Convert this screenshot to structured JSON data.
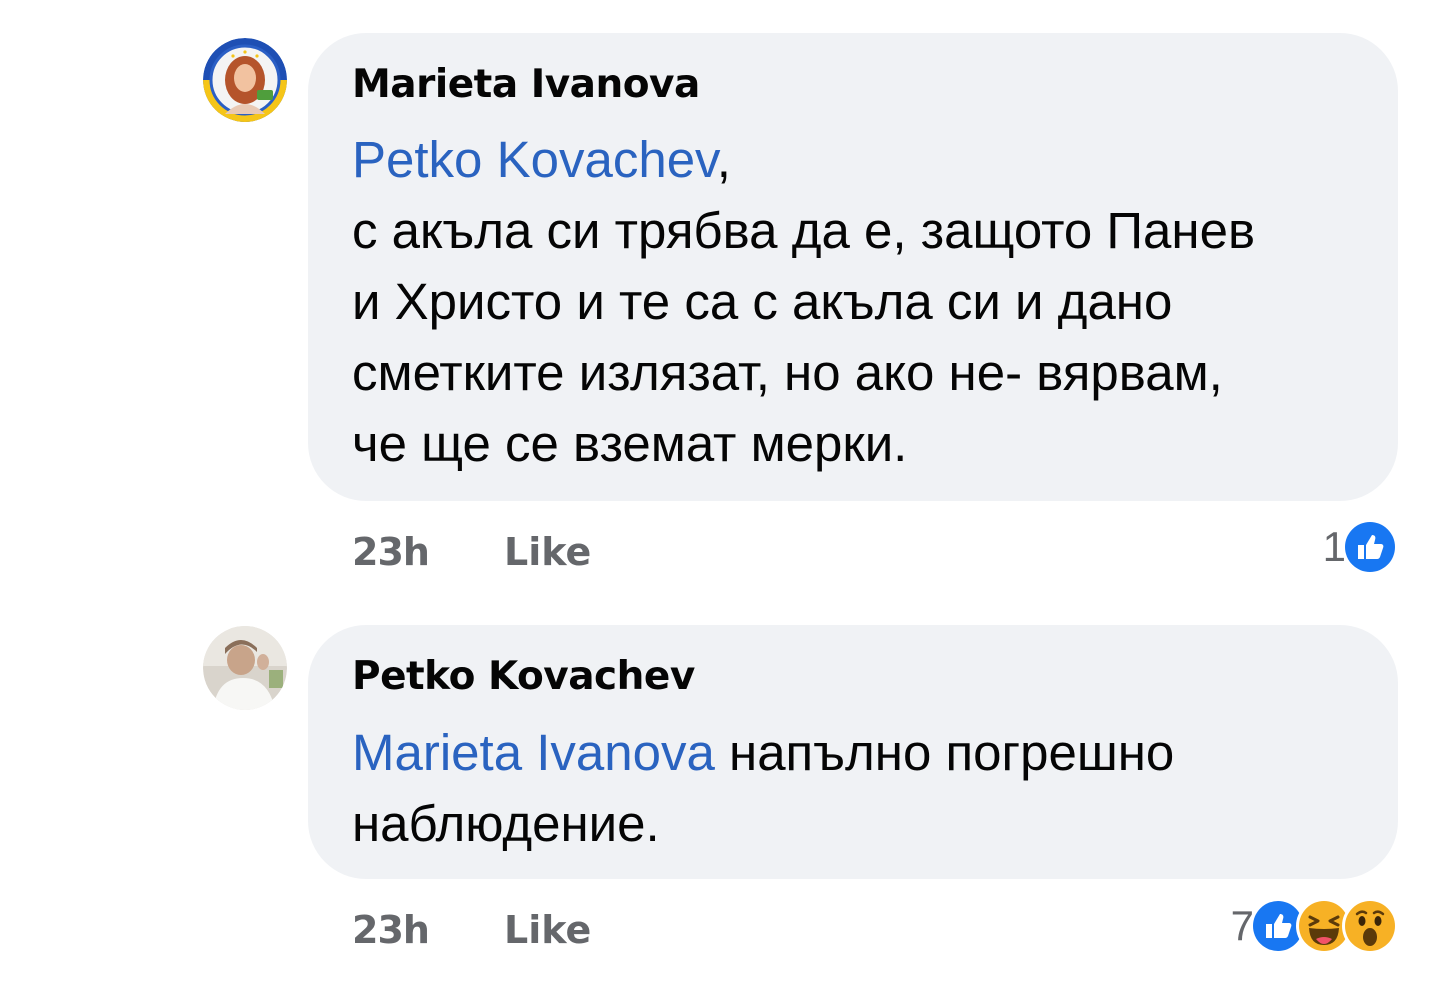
{
  "comments": [
    {
      "author": "Marieta Ivanova",
      "mention": "Petko Kovachev",
      "mention_suffix": ",",
      "body_lines": [
        "с акъла си трябва да е, защото Панев",
        "и Христо и те са с акъла си и дано",
        "сметките излязат, но ако не- вярвам,",
        "че ще се вземат мерки."
      ],
      "time": "23h",
      "like_label": "Like",
      "reaction_count": "1",
      "reaction_icons": [
        "like-icon"
      ],
      "avatar_icon": "avatar-woman-icon"
    },
    {
      "author": "Petko Kovachev",
      "mention": "Marieta Ivanova",
      "inline_text": " напълно погрешно",
      "body_lines": [
        "наблюдение."
      ],
      "time": "23h",
      "like_label": "Like",
      "reaction_count": "7",
      "reaction_icons": [
        "like-icon",
        "haha-icon",
        "wow-icon"
      ],
      "avatar_icon": "avatar-man-icon"
    }
  ],
  "colors": {
    "bubble": "#f0f2f5",
    "mention": "#2a63c0",
    "meta": "#65676b",
    "like_blue": "#1877f2",
    "emoji_yellow": "#f7b125"
  }
}
